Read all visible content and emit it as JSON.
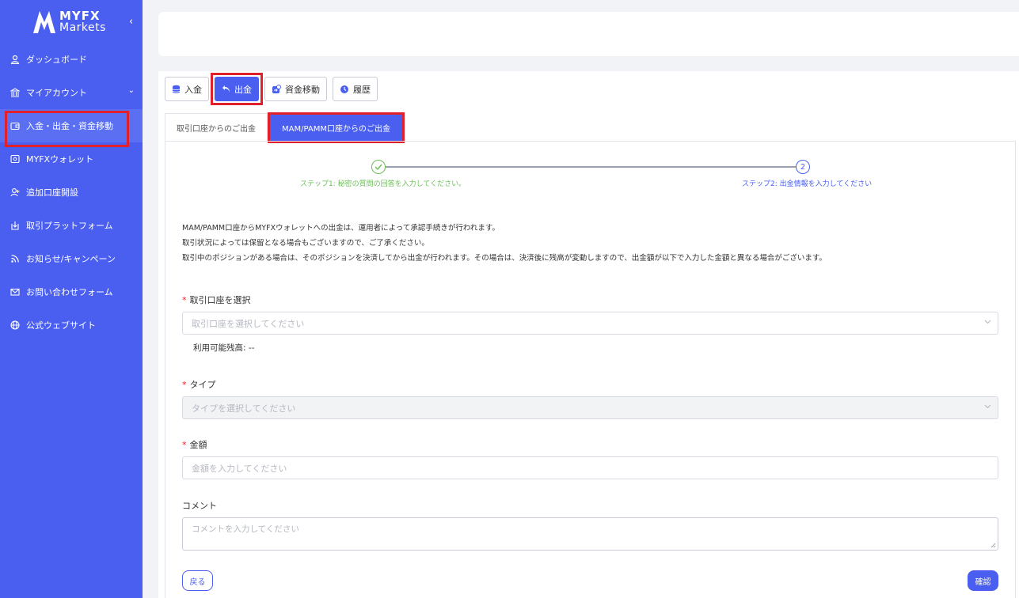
{
  "brand": {
    "line1": "MYFX",
    "line2": "Markets"
  },
  "sidebar": {
    "items": [
      {
        "label": "ダッシュボード",
        "icon": "user-icon"
      },
      {
        "label": "マイアカウント",
        "icon": "bank-icon",
        "has_arrow": true
      },
      {
        "label": "入金・出金・資金移動",
        "icon": "wallet-icon",
        "active": true
      },
      {
        "label": "MYFXウォレット",
        "icon": "wallet-card-icon"
      },
      {
        "label": "追加口座開設",
        "icon": "add-user-icon"
      },
      {
        "label": "取引プラットフォーム",
        "icon": "download-icon"
      },
      {
        "label": "お知らせ/キャンペーン",
        "icon": "rss-icon"
      },
      {
        "label": "お問い合わせフォーム",
        "icon": "mail-icon"
      },
      {
        "label": "公式ウェブサイト",
        "icon": "globe-icon"
      }
    ]
  },
  "toolbar": {
    "deposit": "入金",
    "withdraw": "出金",
    "transfer": "資金移動",
    "history": "履歴"
  },
  "tabs": {
    "trading": "取引口座からのご出金",
    "mam": "MAM/PAMM口座からのご出金"
  },
  "steps": {
    "step1": "ステップ1: 秘密の質問の回答を入力してください。",
    "step2_number": "2",
    "step2": "ステップ2: 出金情報を入力してください"
  },
  "notice": [
    "MAM/PAMM口座からMYFXウォレットへの出金は、運用者によって承認手続きが行われます。",
    "取引状況によっては保留となる場合もございますので、ご了承ください。",
    "取引中のポジションがある場合は、そのポジションを決済してから出金が行われます。その場合は、決済後に残高が変動しますので、出金額が以下で入力した金額と異なる場合がございます。"
  ],
  "form": {
    "account_label": "取引口座を選択",
    "account_placeholder": "取引口座を選択してください",
    "balance": "利用可能残高: --",
    "type_label": "タイプ",
    "type_placeholder": "タイプを選択してください",
    "amount_label": "金額",
    "amount_placeholder": "金額を入力してください",
    "comment_label": "コメント",
    "comment_placeholder": "コメントを入力してください",
    "back": "戻る",
    "confirm": "確認",
    "required_mark": "*"
  },
  "colors": {
    "primary": "#4a5ff0",
    "success": "#6cbf57",
    "highlight": "#e0202a"
  }
}
